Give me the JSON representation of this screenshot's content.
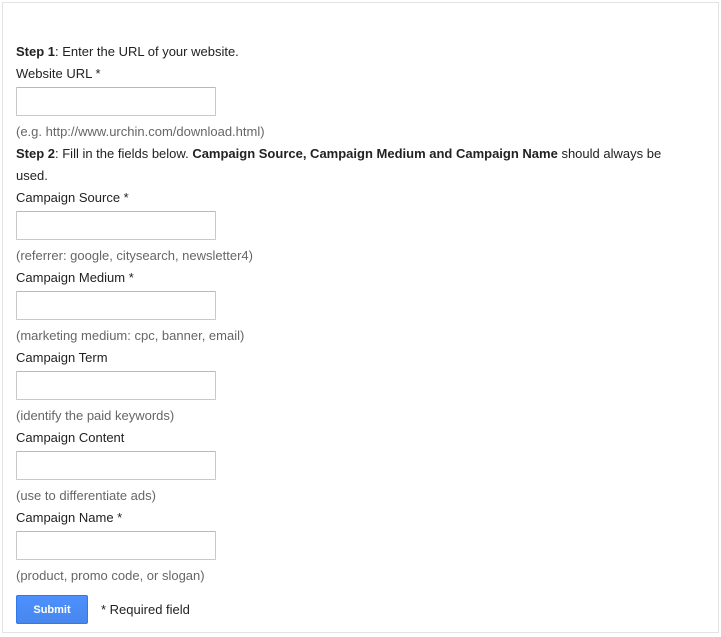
{
  "step1": {
    "label": "Step 1",
    "text": ": Enter the URL of your website."
  },
  "website_url": {
    "label": "Website URL *",
    "value": "",
    "hint": "(e.g. http://www.urchin.com/download.html)"
  },
  "step2": {
    "label": "Step 2",
    "text_before": ": Fill in the fields below. ",
    "bold_fields": "Campaign Source, Campaign Medium and Campaign Name",
    "text_after": " should always be used."
  },
  "fields": [
    {
      "label": "Campaign Source *",
      "value": "",
      "hint": "(referrer: google, citysearch, newsletter4)"
    },
    {
      "label": "Campaign Medium *",
      "value": "",
      "hint": "(marketing medium: cpc, banner, email)"
    },
    {
      "label": "Campaign Term",
      "value": "",
      "hint": "(identify the paid keywords)"
    },
    {
      "label": "Campaign Content",
      "value": "",
      "hint": "(use to differentiate ads)"
    },
    {
      "label": "Campaign Name *",
      "value": "",
      "hint": "(product, promo code, or slogan)"
    }
  ],
  "submit": {
    "label": "Submit",
    "required_note": "* Required field"
  }
}
